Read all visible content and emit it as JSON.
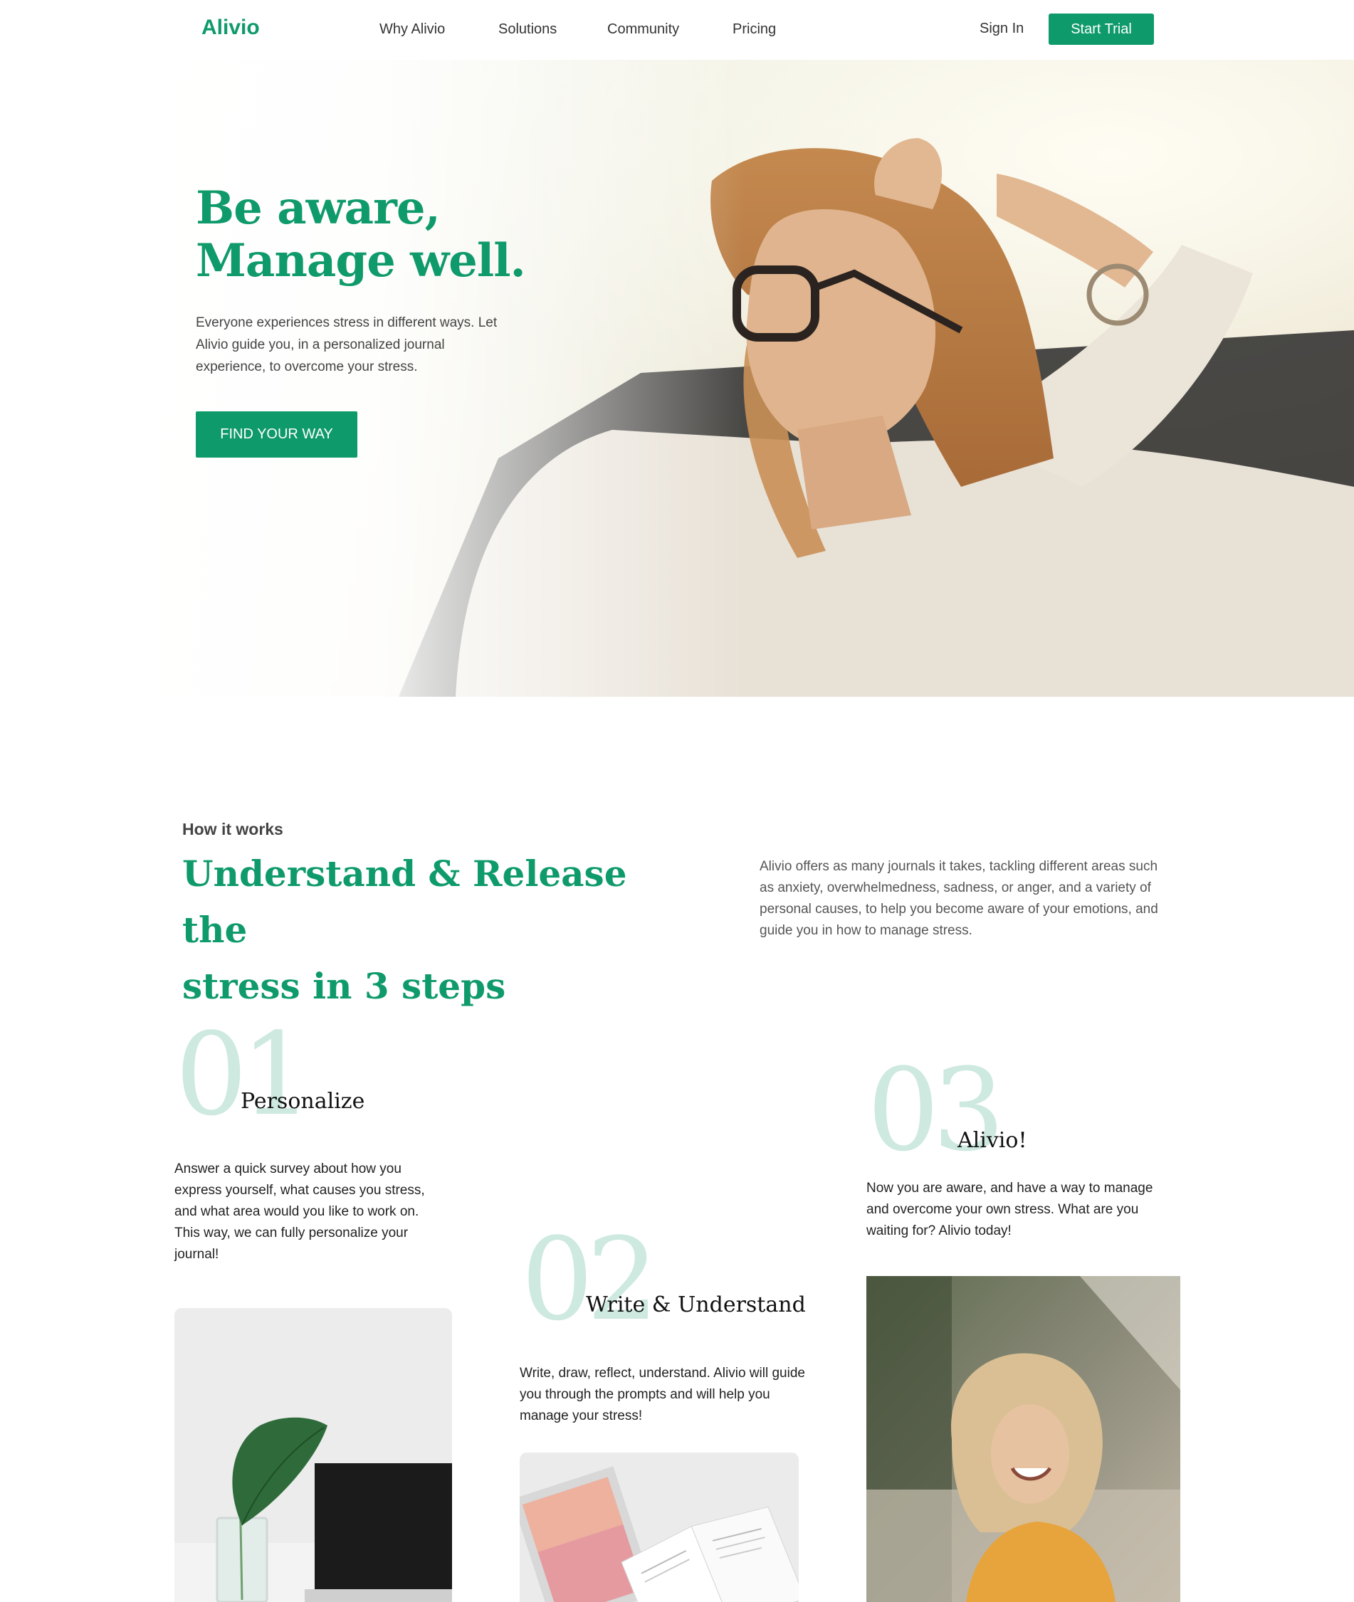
{
  "nav": {
    "logo": "Alivio",
    "links": [
      "Why Alivio",
      "Solutions",
      "Community",
      "Pricing"
    ],
    "sign_in": "Sign In",
    "start_trial": "Start Trial"
  },
  "hero": {
    "title_line1": "Be aware,",
    "title_line2": "Manage well.",
    "description": "Everyone experiences stress in different ways. Let Alivio guide you, in a personalized journal experience, to overcome your stress.",
    "cta": "FIND YOUR WAY",
    "image": "woman-relaxing-photo"
  },
  "how": {
    "kicker": "How it works",
    "title_line1": "Understand & Release the",
    "title_line2": "stress in 3 steps",
    "description": "Alivio offers as many journals it takes, tackling different areas such as anxiety, overwhelmedness, sadness, or anger, and a variety of personal causes, to help you become aware of your emotions, and guide you in how to manage stress."
  },
  "steps": [
    {
      "number": "01",
      "title": "Personalize",
      "text": "Answer a quick survey about how you express yourself, what causes you stress, and what area would you like to work on. This way, we can fully personalize your journal!",
      "image": "plant-and-laptop-photo"
    },
    {
      "number": "02",
      "title": "Write & Understand",
      "text": "Write, draw, reflect, understand. Alivio will guide you through the prompts and will help you manage your stress!",
      "image": "journal-pages-photo"
    },
    {
      "number": "03",
      "title": "Alivio!",
      "text": "Now you are aware, and have a way to manage and overcome your own stress. What are you waiting for? Alivio today!",
      "image": "smiling-woman-photo"
    }
  ],
  "colors": {
    "brand_green": "#0f9a6c",
    "step_number": "#cde9e0"
  }
}
